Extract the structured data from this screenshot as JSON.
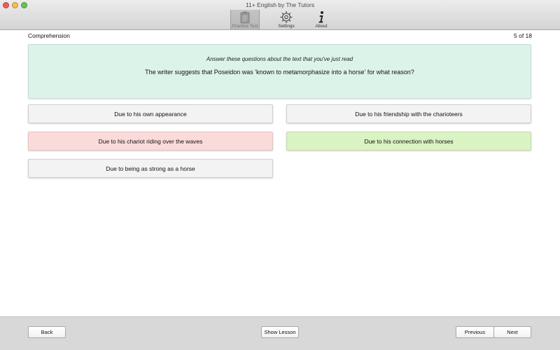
{
  "window": {
    "title": "11+ English by The Tutors"
  },
  "toolbar": {
    "items": [
      {
        "label": "Practice Test",
        "icon": "clipboard-icon",
        "selected": true
      },
      {
        "label": "Settings",
        "icon": "gear-icon",
        "selected": false
      },
      {
        "label": "About",
        "icon": "info-icon",
        "selected": false
      }
    ]
  },
  "header": {
    "section": "Comprehension",
    "counter": "5 of 18"
  },
  "question": {
    "instruction": "Answer these questions about the text that you've just read",
    "text": "The writer suggests that Poseidon was 'known to metamorphasize into a horse' for what reason?"
  },
  "answers": [
    {
      "label": "Due to his own appearance",
      "state": "neutral"
    },
    {
      "label": "Due to his friendship with the charioteers",
      "state": "neutral"
    },
    {
      "label": "Due to his chariot riding over the waves",
      "state": "wrong"
    },
    {
      "label": "Due to his connection with horses",
      "state": "correct"
    },
    {
      "label": "Due to being as strong as a horse",
      "state": "neutral"
    }
  ],
  "colors": {
    "question_bg": "#dcf3ea",
    "wrong_bg": "#fbdada",
    "correct_bg": "#d9f3c2",
    "neutral_bg": "#f3f3f3"
  },
  "footer": {
    "back_label": "Back",
    "lesson_label": "Show Lesson",
    "previous_label": "Previous",
    "next_label": "Next"
  }
}
